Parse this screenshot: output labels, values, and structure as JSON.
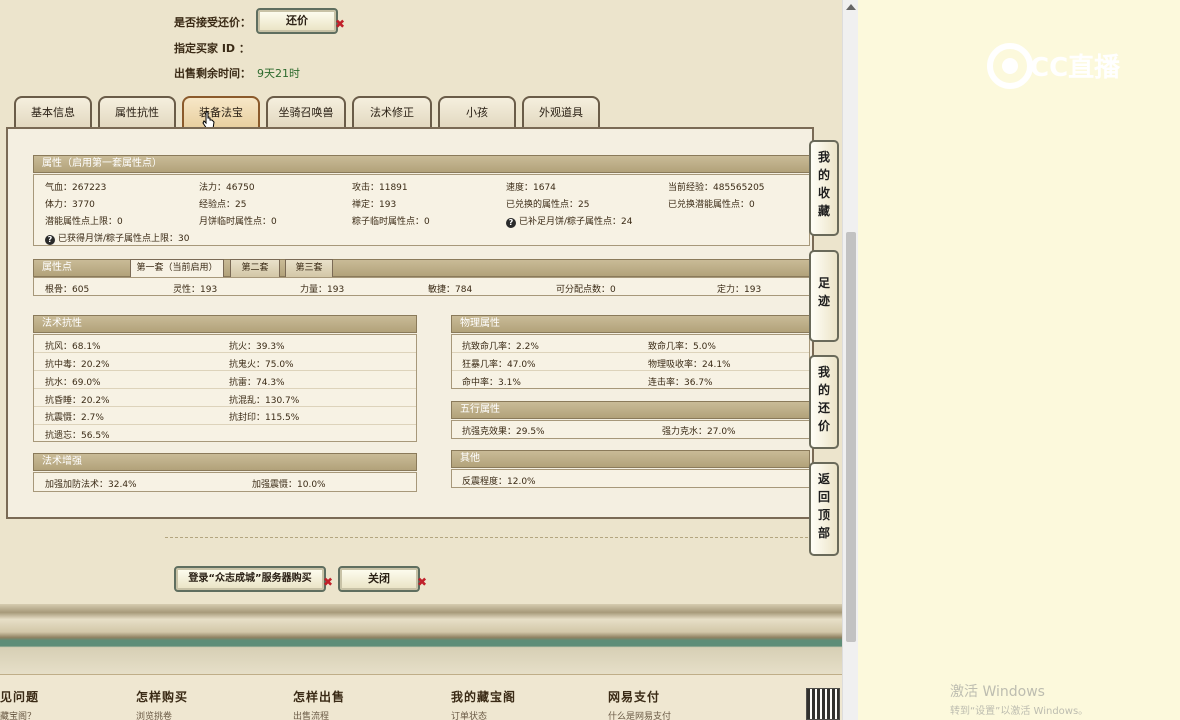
{
  "top_info": {
    "accept_counter_label": "是否接受还价：",
    "counter_button": "还价",
    "buyer_id_label": "指定买家 ID ：",
    "remaining_label": "出售剩余时间：",
    "remaining_value": "9天21时"
  },
  "tabs": [
    {
      "label": "基本信息",
      "active": false
    },
    {
      "label": "属性抗性",
      "active": false
    },
    {
      "label": "装备法宝",
      "active": true
    },
    {
      "label": "坐骑召唤兽",
      "active": false
    },
    {
      "label": "法术修正",
      "active": false
    },
    {
      "label": "小孩",
      "active": false
    },
    {
      "label": "外观道具",
      "active": false
    }
  ],
  "attributes": {
    "title": "属性（启用第一套属性点）",
    "rows": [
      [
        "气血：267223",
        "法力：46750",
        "攻击：11891",
        "速度：1674",
        "当前经验：485565205"
      ],
      [
        "体力：3770",
        "经验点：25",
        "禅定：193",
        "已兑换的属性点：25",
        "已兑换潜能属性点：0"
      ],
      [
        "潜能属性点上限：0",
        "月饼临时属性点：0",
        "粽子临时属性点：0",
        "已补足月饼/粽子属性点：24"
      ],
      [
        "已获得月饼/粽子属性点上限：30"
      ]
    ]
  },
  "points": {
    "title": "属性点",
    "subtabs": [
      "第一套（当前启用）",
      "第二套",
      "第三套"
    ],
    "values": [
      "根骨：605",
      "灵性：193",
      "力量：193",
      "敏捷：784",
      "可分配点数：0",
      "定力：193"
    ]
  },
  "spell_resist": {
    "title": "法术抗性",
    "rows": [
      [
        "抗风：68.1%",
        "抗火：39.3%"
      ],
      [
        "抗中毒：20.2%",
        "抗鬼火：75.0%"
      ],
      [
        "抗水：69.0%",
        "抗雷：74.3%"
      ],
      [
        "抗昏睡：20.2%",
        "抗混乱：130.7%"
      ],
      [
        "抗震慑：2.7%",
        "抗封印：115.5%"
      ],
      [
        "抗遗忘：56.5%",
        ""
      ]
    ]
  },
  "spell_boost": {
    "title": "法术增强",
    "rows": [
      [
        "加强加防法术：32.4%",
        "加强震慑：10.0%"
      ]
    ]
  },
  "physical": {
    "title": "物理属性",
    "rows": [
      [
        "抗致命几率：2.2%",
        "致命几率：5.0%"
      ],
      [
        "狂暴几率：47.0%",
        "物理吸收率：24.1%"
      ],
      [
        "命中率：3.1%",
        "连击率：36.7%"
      ]
    ]
  },
  "five_elements": {
    "title": "五行属性",
    "rows": [
      [
        "抗强克效果：29.5%",
        "强力克水：27.0%"
      ]
    ]
  },
  "other": {
    "title": "其他",
    "rows": [
      [
        "反震程度：12.0%"
      ]
    ]
  },
  "side_tabs": [
    {
      "label": "我的收藏"
    },
    {
      "label": "足迹"
    },
    {
      "label": "我的还价"
    },
    {
      "label": "返回顶部"
    }
  ],
  "buttons": {
    "login_buy": "登录“众志成城”服务器购买",
    "close": "关闭"
  },
  "footer": [
    {
      "title": "见问题",
      "sub": "藏宝阁？"
    },
    {
      "title": "怎样购买",
      "sub": "浏览挑卷"
    },
    {
      "title": "怎样出售",
      "sub": "出售流程"
    },
    {
      "title": "我的藏宝阁",
      "sub": "订单状态"
    },
    {
      "title": "网易支付",
      "sub": "什么是网易支付"
    }
  ],
  "overlay": {
    "logo_text": "CC直播",
    "activate_title": "激活 Windows",
    "activate_sub": "转到“设置”以激活 Windows。"
  },
  "colors": {
    "accent_green": "#5e8d78",
    "panel_header": "#b2a27a",
    "close_x": "#c0202a"
  }
}
